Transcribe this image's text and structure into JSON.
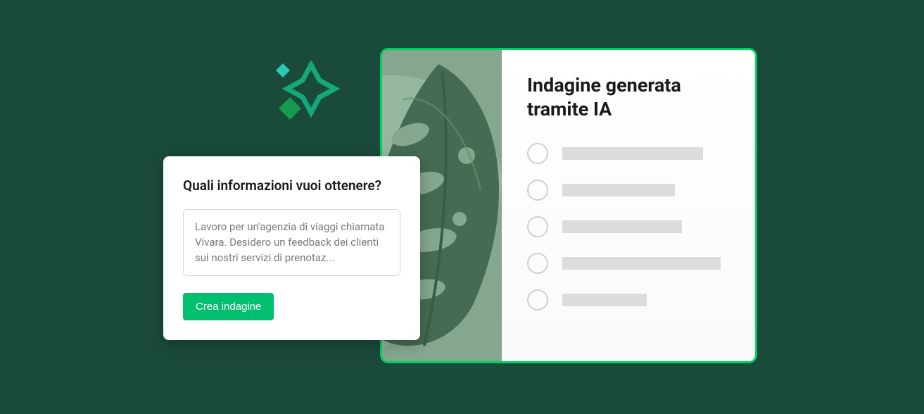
{
  "prompt": {
    "title": "Quali informazioni vuoi ottenere?",
    "textarea_value": "Lavoro per un'agenzia di viaggi chiamata Vivara. Desidero un feedback dei clienti sui nostri servizi di prenotaz...",
    "create_button_label": "Crea indagine"
  },
  "survey": {
    "title": "Indagine generata tramite IA"
  },
  "colors": {
    "background": "#1a4a3a",
    "accent": "#00bf6f",
    "border_accent": "#00d060",
    "sparkle_teal": "#1fb6a8",
    "sparkle_green_dark": "#0a7a4a",
    "sparkle_green_light": "#1ea85a"
  }
}
